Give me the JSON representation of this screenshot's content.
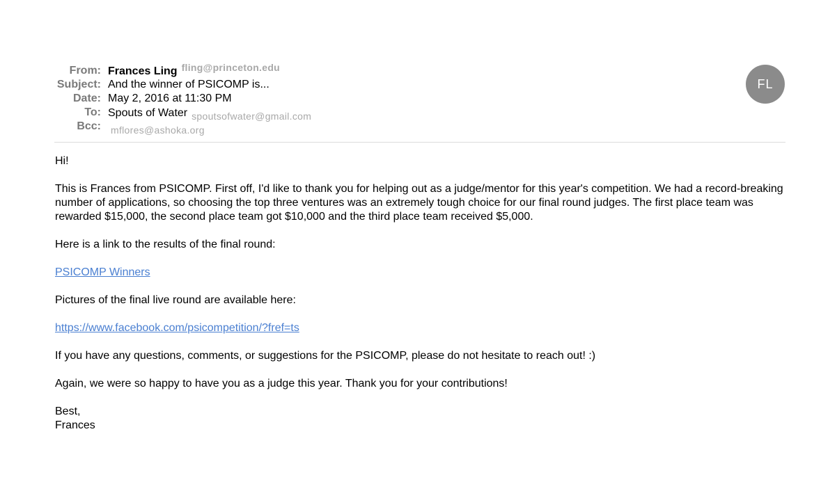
{
  "header": {
    "from_label": "From:",
    "from_name": "Frances Ling",
    "from_redacted": "fling@princeton.edu",
    "subject_label": "Subject:",
    "subject": "And the winner of PSICOMP is...",
    "date_label": "Date:",
    "date": "May 2, 2016 at 11:30 PM",
    "to_label": "To:",
    "to_name": "Spouts of Water",
    "to_redacted": "spoutsofwater@gmail.com",
    "bcc_label": "Bcc:",
    "bcc_redacted": "mflores@ashoka.org"
  },
  "avatar": {
    "initials": "FL",
    "color": "#8b8b8b"
  },
  "body": {
    "greeting": "Hi!",
    "paragraph1": "This is Frances from PSICOMP. First off, I'd like to thank you for helping out as a judge/mentor for this year's competition. We had a record-breaking number of applications, so choosing the top three ventures was an extremely tough choice for our final round judges. The first place team was rewarded $15,000, the second place team got $10,000 and the third place team received $5,000.",
    "results_intro": "Here is a link to the results of the final round:",
    "winners_link": "PSICOMP Winners",
    "pictures_intro": "Pictures of the final live round are available here:",
    "facebook_link": "https://www.facebook.com/psicompetition/?fref=ts",
    "questions": "If you have any questions, comments, or suggestions for the PSICOMP, please do not hesitate to reach out! :)",
    "thanks": "Again, we were so happy to have you as a judge this year. Thank you for your contributions!",
    "closing": "Best,",
    "signature": "Frances"
  },
  "colors": {
    "link": "#4a7fd1",
    "label": "#7a7a7a",
    "divider": "#dcdcdc"
  }
}
